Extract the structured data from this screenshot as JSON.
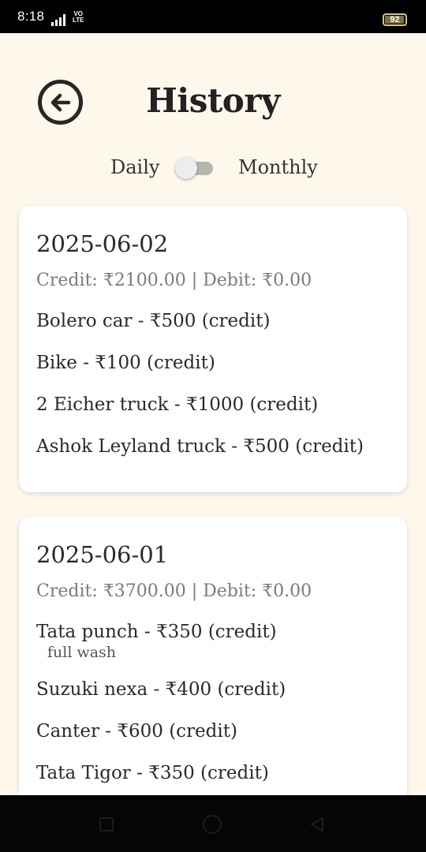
{
  "status_bar": {
    "time": "8:18",
    "network_label_top": "VO",
    "network_label_bottom": "LTE",
    "battery": "92"
  },
  "header": {
    "title": "History",
    "back_icon": "arrow-left-circle-icon"
  },
  "toggle": {
    "left_label": "Daily",
    "right_label": "Monthly",
    "state": "off"
  },
  "days": [
    {
      "date": "2025-06-02",
      "summary": "Credit: ₹2100.00 | Debit: ₹0.00",
      "entries": [
        {
          "text": "Bolero car - ₹500 (credit)"
        },
        {
          "text": "Bike - ₹100 (credit)"
        },
        {
          "text": "2 Eicher truck - ₹1000 (credit)"
        },
        {
          "text": "Ashok Leyland truck - ₹500 (credit)"
        }
      ]
    },
    {
      "date": "2025-06-01",
      "summary": "Credit: ₹3700.00 | Debit: ₹0.00",
      "entries": [
        {
          "text": "Tata punch - ₹350 (credit)",
          "note": "full wash"
        },
        {
          "text": "Suzuki nexa - ₹400 (credit)"
        },
        {
          "text": "Canter - ₹600 (credit)"
        },
        {
          "text": "Tata Tigor - ₹350 (credit)"
        }
      ]
    }
  ],
  "colors": {
    "background": "#FDF7EC",
    "card": "#FFFFFF",
    "title_text": "#222222",
    "summary_text": "#7B7B7B"
  }
}
